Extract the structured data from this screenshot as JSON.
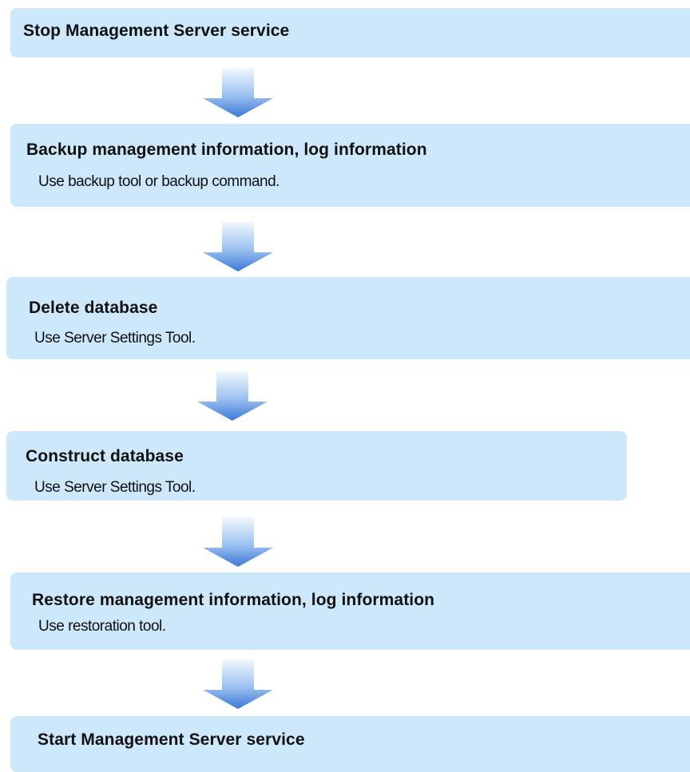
{
  "steps": [
    {
      "title": "Stop Management  Server service",
      "description": ""
    },
    {
      "title": "Backup management information, log information",
      "description": "Use backup tool or backup command."
    },
    {
      "title": "Delete database",
      "description": "Use Server Settings Tool."
    },
    {
      "title": "Construct  database",
      "description": "Use Server Settings Tool."
    },
    {
      "title": "Restore management  information, log information",
      "description": "Use restoration tool."
    },
    {
      "title": "Start Management  Server service",
      "description": ""
    }
  ],
  "colors": {
    "box_fill": "#cde8fb",
    "arrow_light": "#f2f8fe",
    "arrow_dark": "#3c78d8"
  },
  "icons": {
    "arrow": "down-arrow-icon"
  }
}
